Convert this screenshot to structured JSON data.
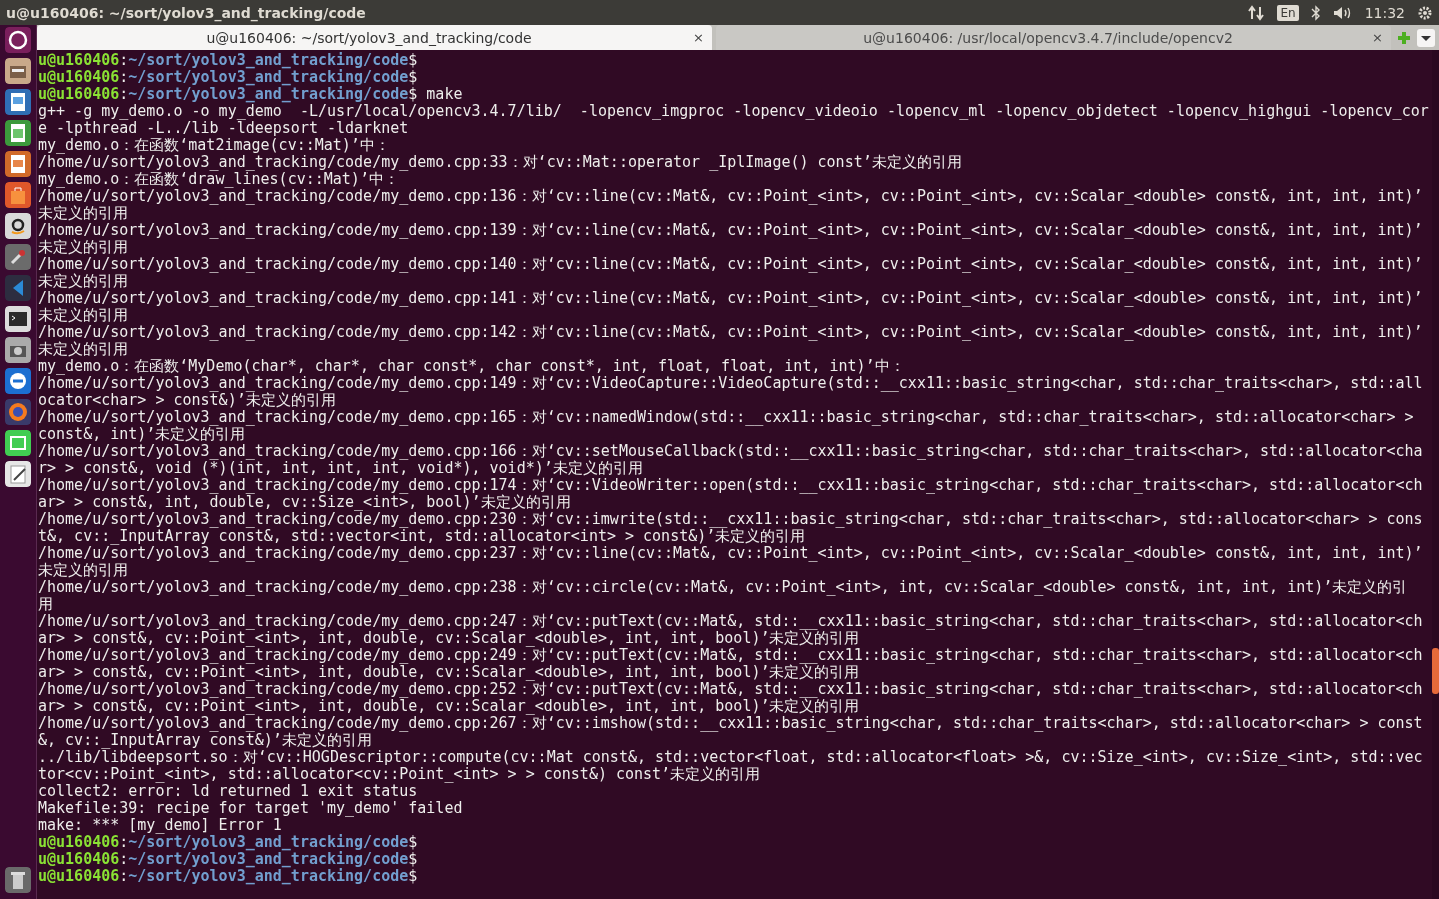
{
  "top_panel": {
    "title": "u@u160406: ~/sort/yolov3_and_tracking/code",
    "keyboard_layout": "En",
    "time": "11:32"
  },
  "tabs": [
    {
      "title": "u@u160406: ~/sort/yolov3_and_tracking/code",
      "close": "×",
      "selected": true
    },
    {
      "title": "u@u160406: /usr/local/opencv3.4.7/include/opencv2",
      "close": "×",
      "selected": false
    }
  ],
  "terminal": {
    "lines": [
      {
        "kind": "prompt",
        "user": "u@u160406",
        "separator": ":",
        "path": "~/sort/yolov3_and_tracking/code",
        "symbol": "$"
      },
      {
        "kind": "prompt",
        "user": "u@u160406",
        "separator": ":",
        "path": "~/sort/yolov3_and_tracking/code",
        "symbol": "$"
      },
      {
        "kind": "prompt",
        "user": "u@u160406",
        "separator": ":",
        "path": "~/sort/yolov3_and_tracking/code",
        "symbol": "$",
        "command": "make"
      },
      {
        "kind": "output",
        "text": "g++ -g my_demo.o -o my_demo  -L/usr/local/opencv3.4.7/lib/  -lopencv_imgproc -lopencv_videoio -lopencv_ml -lopencv_objdetect -lopencv_highgui -lopencv_cor"
      },
      {
        "kind": "output",
        "text": "e -lpthread -L../lib -ldeepsort -ldarknet"
      },
      {
        "kind": "output",
        "text": "my_demo.o：在函数‘mat2image(cv::Mat)’中："
      },
      {
        "kind": "output",
        "text": "/home/u/sort/yolov3_and_tracking/code/my_demo.cpp:33：对‘cv::Mat::operator _IplImage() const’未定义的引用"
      },
      {
        "kind": "output",
        "text": "my_demo.o：在函数‘draw_lines(cv::Mat)’中："
      },
      {
        "kind": "output",
        "text": "/home/u/sort/yolov3_and_tracking/code/my_demo.cpp:136：对‘cv::line(cv::Mat&, cv::Point_<int>, cv::Point_<int>, cv::Scalar_<double> const&, int, int, int)’"
      },
      {
        "kind": "output",
        "text": "未定义的引用"
      },
      {
        "kind": "output",
        "text": "/home/u/sort/yolov3_and_tracking/code/my_demo.cpp:139：对‘cv::line(cv::Mat&, cv::Point_<int>, cv::Point_<int>, cv::Scalar_<double> const&, int, int, int)’"
      },
      {
        "kind": "output",
        "text": "未定义的引用"
      },
      {
        "kind": "output",
        "text": "/home/u/sort/yolov3_and_tracking/code/my_demo.cpp:140：对‘cv::line(cv::Mat&, cv::Point_<int>, cv::Point_<int>, cv::Scalar_<double> const&, int, int, int)’"
      },
      {
        "kind": "output",
        "text": "未定义的引用"
      },
      {
        "kind": "output",
        "text": "/home/u/sort/yolov3_and_tracking/code/my_demo.cpp:141：对‘cv::line(cv::Mat&, cv::Point_<int>, cv::Point_<int>, cv::Scalar_<double> const&, int, int, int)’"
      },
      {
        "kind": "output",
        "text": "未定义的引用"
      },
      {
        "kind": "output",
        "text": "/home/u/sort/yolov3_and_tracking/code/my_demo.cpp:142：对‘cv::line(cv::Mat&, cv::Point_<int>, cv::Point_<int>, cv::Scalar_<double> const&, int, int, int)’"
      },
      {
        "kind": "output",
        "text": "未定义的引用"
      },
      {
        "kind": "output",
        "text": "my_demo.o：在函数‘MyDemo(char*, char*, char const*, char const*, int, float, float, int, int)’中："
      },
      {
        "kind": "output",
        "text": "/home/u/sort/yolov3_and_tracking/code/my_demo.cpp:149：对‘cv::VideoCapture::VideoCapture(std::__cxx11::basic_string<char, std::char_traits<char>, std::all"
      },
      {
        "kind": "output",
        "text": "ocator<char> > const&)’未定义的引用"
      },
      {
        "kind": "output",
        "text": "/home/u/sort/yolov3_and_tracking/code/my_demo.cpp:165：对‘cv::namedWindow(std::__cxx11::basic_string<char, std::char_traits<char>, std::allocator<char> >"
      },
      {
        "kind": "output",
        "text": "const&, int)’未定义的引用"
      },
      {
        "kind": "output",
        "text": "/home/u/sort/yolov3_and_tracking/code/my_demo.cpp:166：对‘cv::setMouseCallback(std::__cxx11::basic_string<char, std::char_traits<char>, std::allocator<cha"
      },
      {
        "kind": "output",
        "text": "r> > const&, void (*)(int, int, int, int, void*), void*)’未定义的引用"
      },
      {
        "kind": "output",
        "text": "/home/u/sort/yolov3_and_tracking/code/my_demo.cpp:174：对‘cv::VideoWriter::open(std::__cxx11::basic_string<char, std::char_traits<char>, std::allocator<ch"
      },
      {
        "kind": "output",
        "text": "ar> > const&, int, double, cv::Size_<int>, bool)’未定义的引用"
      },
      {
        "kind": "output",
        "text": "/home/u/sort/yolov3_and_tracking/code/my_demo.cpp:230：对‘cv::imwrite(std::__cxx11::basic_string<char, std::char_traits<char>, std::allocator<char> > cons"
      },
      {
        "kind": "output",
        "text": "t&, cv::_InputArray const&, std::vector<int, std::allocator<int> > const&)’未定义的引用"
      },
      {
        "kind": "output",
        "text": "/home/u/sort/yolov3_and_tracking/code/my_demo.cpp:237：对‘cv::line(cv::Mat&, cv::Point_<int>, cv::Point_<int>, cv::Scalar_<double> const&, int, int, int)’"
      },
      {
        "kind": "output",
        "text": "未定义的引用"
      },
      {
        "kind": "output",
        "text": "/home/u/sort/yolov3_and_tracking/code/my_demo.cpp:238：对‘cv::circle(cv::Mat&, cv::Point_<int>, int, cv::Scalar_<double> const&, int, int, int)’未定义的引"
      },
      {
        "kind": "output",
        "text": "用"
      },
      {
        "kind": "output",
        "text": "/home/u/sort/yolov3_and_tracking/code/my_demo.cpp:247：对‘cv::putText(cv::Mat&, std::__cxx11::basic_string<char, std::char_traits<char>, std::allocator<ch"
      },
      {
        "kind": "output",
        "text": "ar> > const&, cv::Point_<int>, int, double, cv::Scalar_<double>, int, int, bool)’未定义的引用"
      },
      {
        "kind": "output",
        "text": "/home/u/sort/yolov3_and_tracking/code/my_demo.cpp:249：对‘cv::putText(cv::Mat&, std::__cxx11::basic_string<char, std::char_traits<char>, std::allocator<ch"
      },
      {
        "kind": "output",
        "text": "ar> > const&, cv::Point_<int>, int, double, cv::Scalar_<double>, int, int, bool)’未定义的引用"
      },
      {
        "kind": "output",
        "text": "/home/u/sort/yolov3_and_tracking/code/my_demo.cpp:252：对‘cv::putText(cv::Mat&, std::__cxx11::basic_string<char, std::char_traits<char>, std::allocator<ch"
      },
      {
        "kind": "output",
        "text": "ar> > const&, cv::Point_<int>, int, double, cv::Scalar_<double>, int, int, bool)’未定义的引用"
      },
      {
        "kind": "output",
        "text": "/home/u/sort/yolov3_and_tracking/code/my_demo.cpp:267：对‘cv::imshow(std::__cxx11::basic_string<char, std::char_traits<char>, std::allocator<char> > const"
      },
      {
        "kind": "output",
        "text": "&, cv::_InputArray const&)’未定义的引用"
      },
      {
        "kind": "output",
        "text": "../lib/libdeepsort.so：对‘cv::HOGDescriptor::compute(cv::Mat const&, std::vector<float, std::allocator<float> >&, cv::Size_<int>, cv::Size_<int>, std::vec"
      },
      {
        "kind": "output",
        "text": "tor<cv::Point_<int>, std::allocator<cv::Point_<int> > > const&) const’未定义的引用"
      },
      {
        "kind": "output",
        "text": "collect2: error: ld returned 1 exit status"
      },
      {
        "kind": "output",
        "text": "Makefile:39: recipe for target 'my_demo' failed"
      },
      {
        "kind": "output",
        "text": "make: *** [my_demo] Error 1"
      },
      {
        "kind": "prompt",
        "user": "u@u160406",
        "separator": ":",
        "path": "~/sort/yolov3_and_tracking/code",
        "symbol": "$"
      },
      {
        "kind": "prompt",
        "user": "u@u160406",
        "separator": ":",
        "path": "~/sort/yolov3_and_tracking/code",
        "symbol": "$"
      },
      {
        "kind": "prompt",
        "user": "u@u160406",
        "separator": ":",
        "path": "~/sort/yolov3_and_tracking/code",
        "symbol": "$"
      }
    ]
  }
}
